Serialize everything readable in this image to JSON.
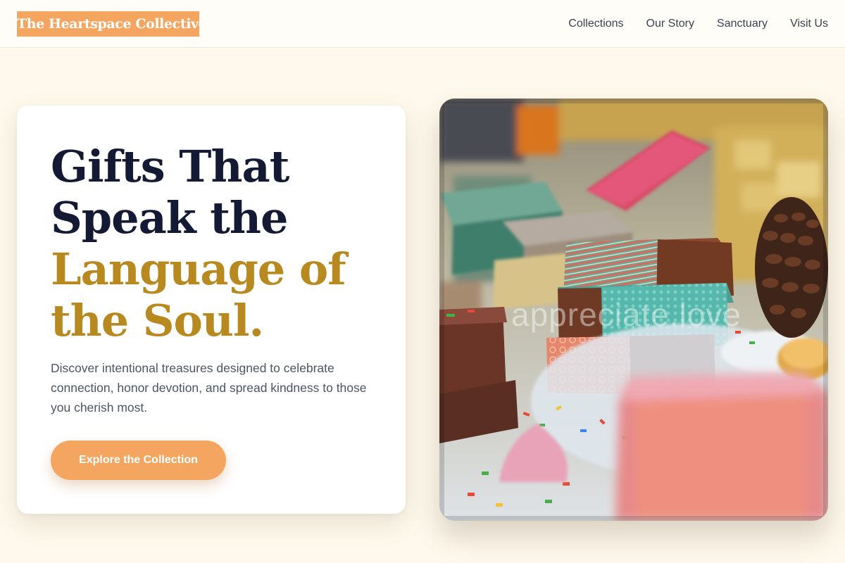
{
  "brand": {
    "name": "The Heartspace Collective"
  },
  "nav": {
    "items": [
      {
        "label": "Collections"
      },
      {
        "label": "Our Story"
      },
      {
        "label": "Sanctuary"
      },
      {
        "label": "Visit Us"
      }
    ]
  },
  "hero": {
    "headline_line1": "Gifts That",
    "headline_line2": "Speak the",
    "headline_accent_line1": "Language of",
    "headline_accent_line2": "the Soul.",
    "description": "Discover intentional treasures designed to celebrate connection, honor devotion, and spread kindness to those you cherish most.",
    "cta_label": "Explore the Collection"
  },
  "photo": {
    "watermark": "appreciate.love"
  },
  "colors": {
    "page_background": "#fef9ec",
    "brand_accent": "#f4a55f",
    "headline_dark": "#141a33",
    "headline_gold": "#b8891f",
    "body_text": "#4b5563"
  }
}
